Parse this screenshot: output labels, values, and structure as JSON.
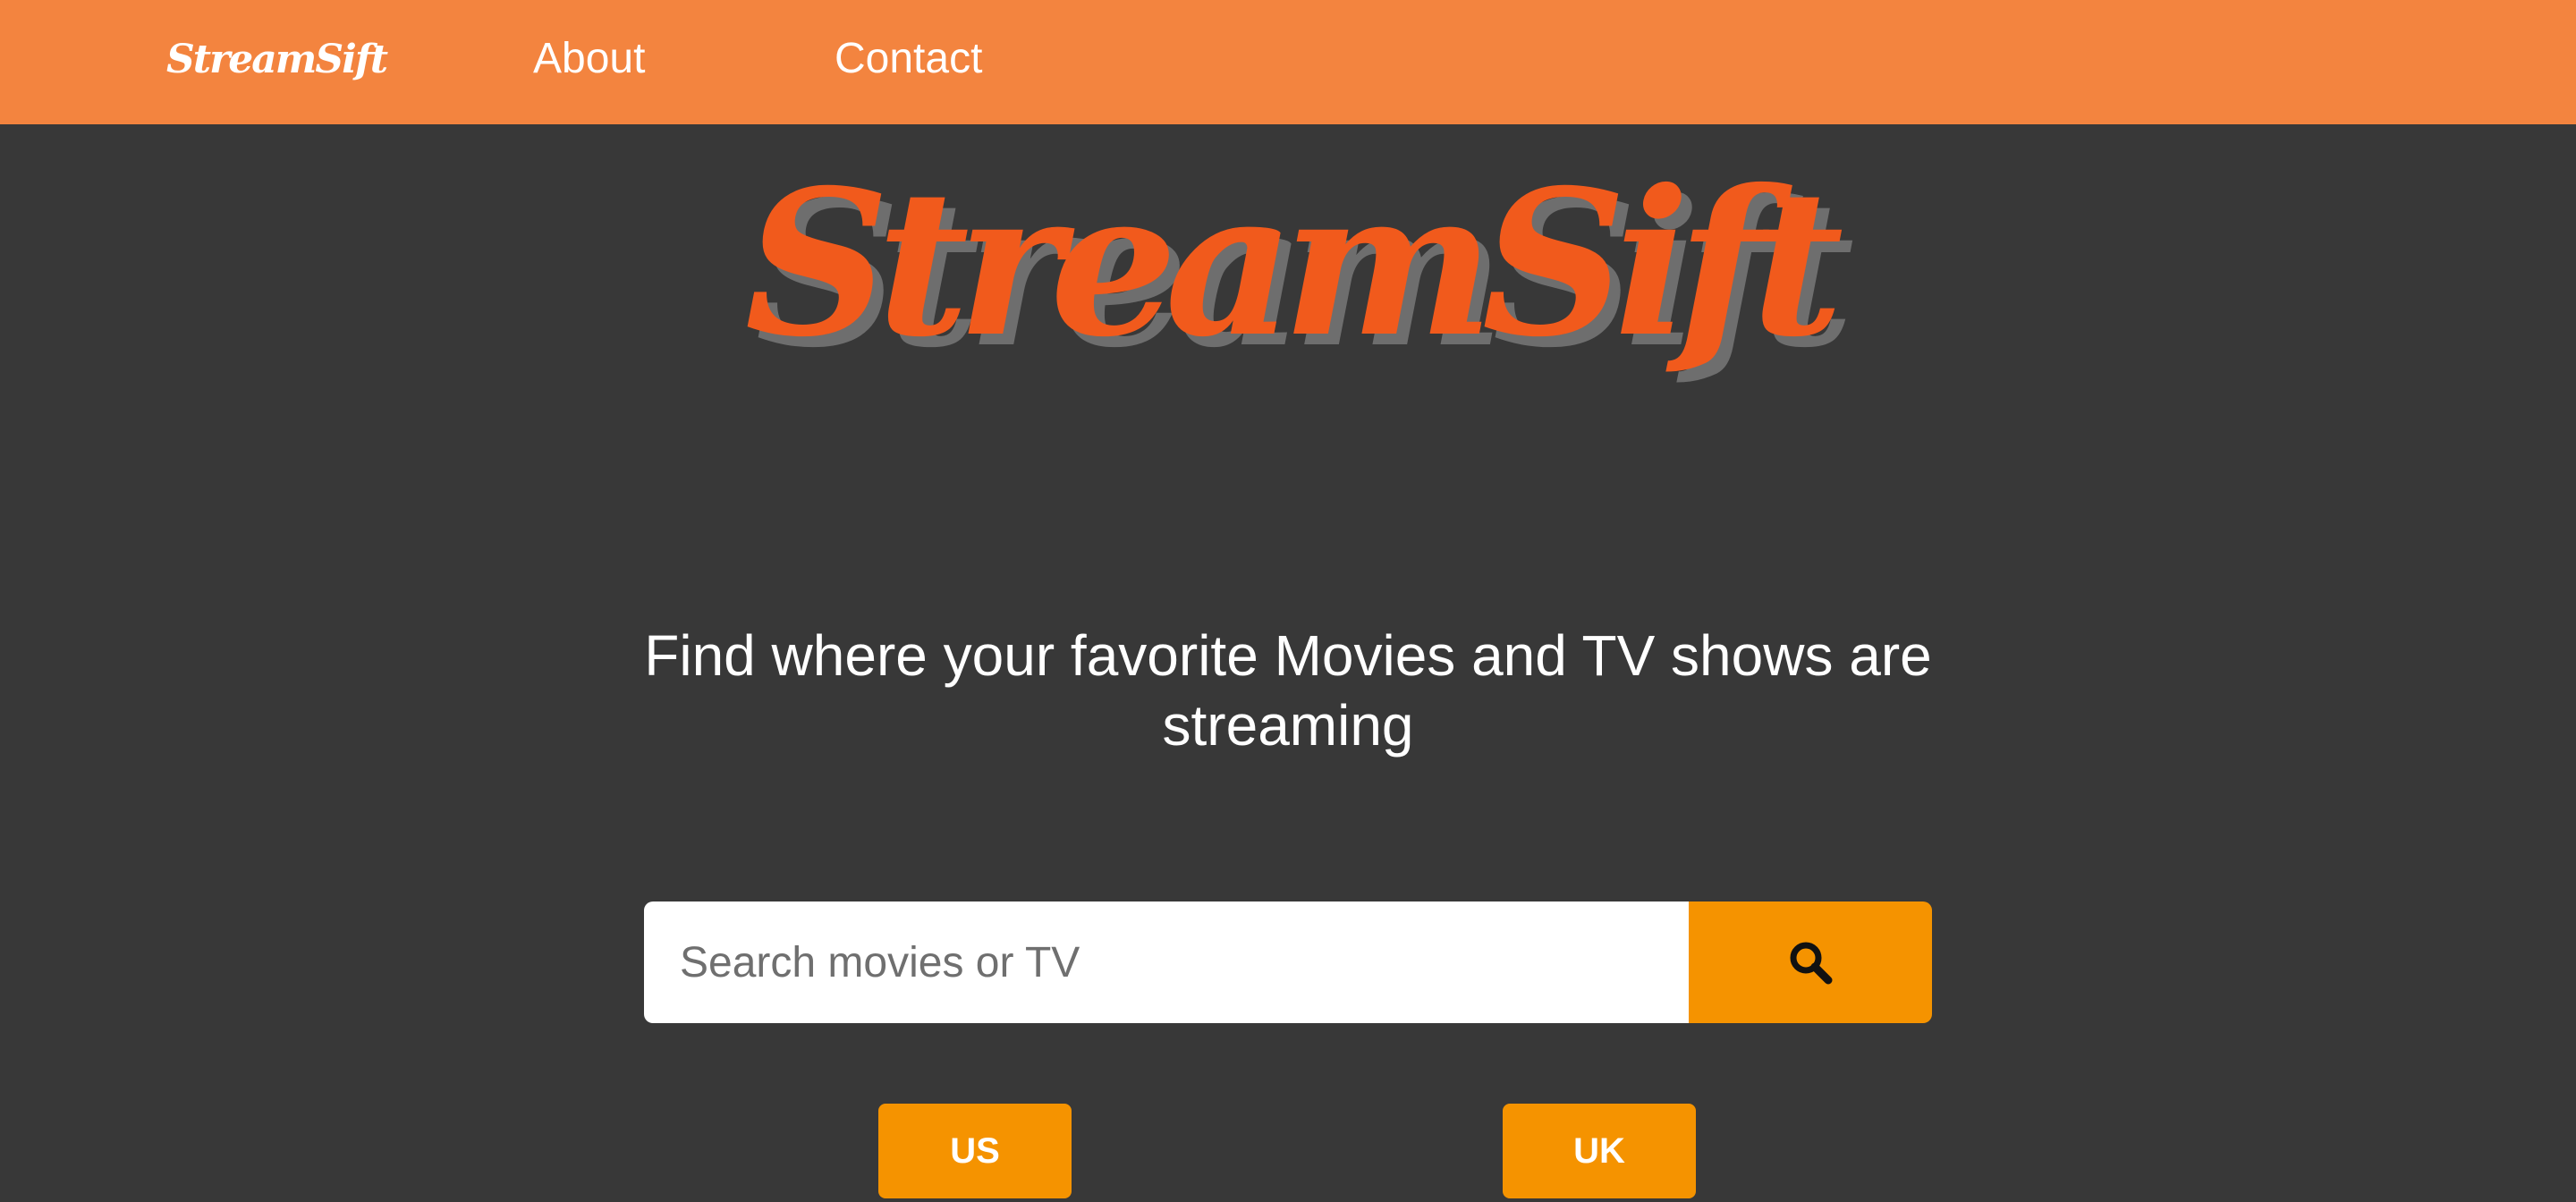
{
  "navbar": {
    "logo_text": "StreamSift",
    "links": [
      {
        "label": "About"
      },
      {
        "label": "Contact"
      }
    ]
  },
  "hero": {
    "logo_text": "StreamSift",
    "tagline": "Find where your favorite Movies and TV shows are streaming"
  },
  "search": {
    "placeholder": "Search movies or TV",
    "value": "",
    "button_icon": "search-icon"
  },
  "regions": [
    {
      "label": "US"
    },
    {
      "label": "UK"
    }
  ],
  "colors": {
    "navbar_bg": "#F3843F",
    "page_bg": "#383838",
    "hero_logo": "#F15A1C",
    "hero_logo_shadow": "#6e6e6e",
    "button_bg": "#F59300",
    "text_light": "#ffffff"
  }
}
